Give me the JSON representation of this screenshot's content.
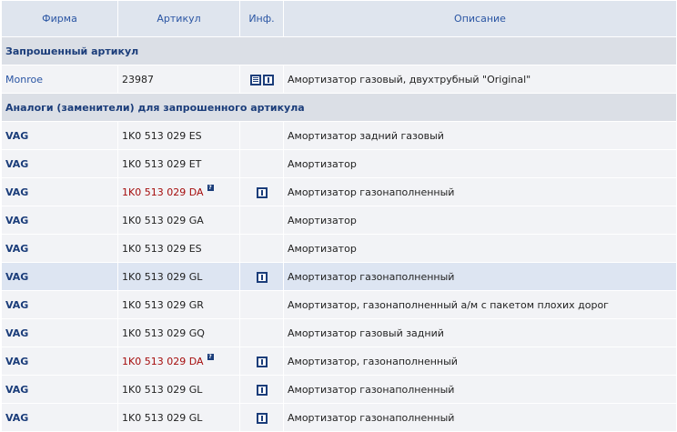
{
  "columns": {
    "firm": "Фирма",
    "article": "Артикул",
    "info": "Инф.",
    "description": "Описание"
  },
  "requested_section": {
    "title": "Запрошенный артикул",
    "row": {
      "firm": "Monroe",
      "article": "23987",
      "icons": [
        "document-icon",
        "info-icon"
      ],
      "description": "Амортизатор газовый, двухтрубный \"Original\""
    }
  },
  "analogs_section": {
    "title": "Аналоги (заменители) для запрошенного артикула",
    "rows": [
      {
        "firm": "VAG",
        "article": "1K0 513 029 ES",
        "red": false,
        "question": false,
        "info": false,
        "highlight": false,
        "description": "Амортизатор задний газовый"
      },
      {
        "firm": "VAG",
        "article": "1K0 513 029 ET",
        "red": false,
        "question": false,
        "info": false,
        "highlight": false,
        "description": "Амортизатор"
      },
      {
        "firm": "VAG",
        "article": "1K0 513 029 DA",
        "red": true,
        "question": true,
        "info": true,
        "highlight": false,
        "description": "Амортизатор газонаполненный"
      },
      {
        "firm": "VAG",
        "article": "1K0 513 029 GA",
        "red": false,
        "question": false,
        "info": false,
        "highlight": false,
        "description": "Амортизатор"
      },
      {
        "firm": "VAG",
        "article": "1K0 513 029 ES",
        "red": false,
        "question": false,
        "info": false,
        "highlight": false,
        "description": "Амортизатор"
      },
      {
        "firm": "VAG",
        "article": "1K0 513 029 GL",
        "red": false,
        "question": false,
        "info": true,
        "highlight": true,
        "description": "Амортизатор газонаполненный"
      },
      {
        "firm": "VAG",
        "article": "1K0 513 029 GR",
        "red": false,
        "question": false,
        "info": false,
        "highlight": false,
        "description": "Амортизатор, газонаполненный а/м с пакетом плохих дорог"
      },
      {
        "firm": "VAG",
        "article": "1K0 513 029 GQ",
        "red": false,
        "question": false,
        "info": false,
        "highlight": false,
        "description": "Амортизатор газовый задний"
      },
      {
        "firm": "VAG",
        "article": "1K0 513 029 DA",
        "red": true,
        "question": true,
        "info": true,
        "highlight": false,
        "description": "Амортизатор, газонаполненный"
      },
      {
        "firm": "VAG",
        "article": "1K0 513 029 GL",
        "red": false,
        "question": false,
        "info": true,
        "highlight": false,
        "description": "Амортизатор газонаполненный"
      },
      {
        "firm": "VAG",
        "article": "1K0 513 029 GL",
        "red": false,
        "question": false,
        "info": true,
        "highlight": false,
        "description": "Амортизатор газонаполненный"
      }
    ]
  },
  "question_glyph": "?"
}
